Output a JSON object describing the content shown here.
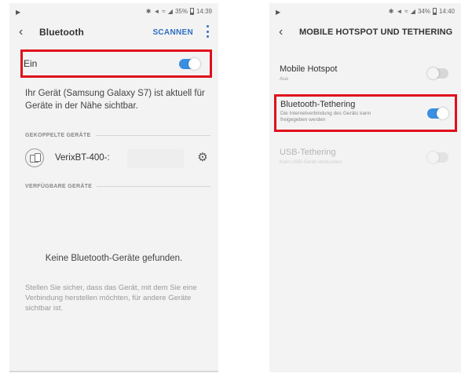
{
  "left_phone": {
    "status": {
      "icons": "✱ ◀ ≡ ▮",
      "battery": "35%",
      "time": "14:39"
    },
    "appbar": {
      "title": "Bluetooth",
      "scan_label": "SCANNEN"
    },
    "toggle_row": {
      "label": "Ein",
      "state": "on"
    },
    "description": "Ihr Gerät (Samsung Galaxy S7) ist aktuell für Geräte in der Nähe sichtbar.",
    "paired_section": "GEKOPPELTE GERÄTE",
    "paired_device": {
      "name": "VerixBT-400-:"
    },
    "available_section": "VERFÜGBARE GERÄTE",
    "empty_message": "Keine Bluetooth-Geräte gefunden.",
    "hint": "Stellen Sie sicher, dass das Gerät, mit dem Sie eine Verbindung herstellen möchten, für andere Geräte sichtbar ist."
  },
  "right_phone": {
    "status": {
      "battery": "34%",
      "time": "14:40"
    },
    "appbar": {
      "title": "MOBILE HOTSPOT UND TETHERING"
    },
    "items": [
      {
        "title": "Mobile Hotspot",
        "subtitle": "Aus",
        "state": "off"
      },
      {
        "title": "Bluetooth-Tethering",
        "subtitle": "Die Internetverbindung des Geräts kann freigegeben werden",
        "state": "on"
      },
      {
        "title": "USB-Tethering",
        "subtitle": "Kein USB-Gerät verbunden",
        "state": "disabled"
      }
    ]
  },
  "colors": {
    "accent": "#3a8ee0",
    "highlight": "#e0101c",
    "scan_text": "#2e6fc0"
  }
}
